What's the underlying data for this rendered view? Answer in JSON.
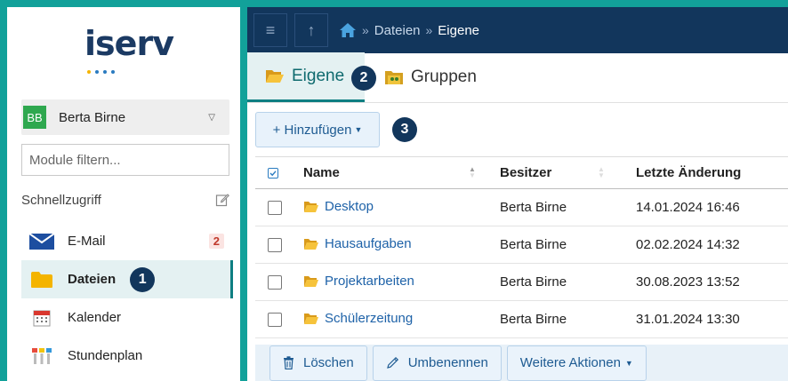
{
  "colors": {
    "frame": "#12a19a",
    "topbar": "#12365c",
    "accent": "#0e7f82",
    "link": "#1e62a8",
    "badge": "#12365c"
  },
  "logo": {
    "text": "iserv"
  },
  "user": {
    "initials": "BB",
    "name": "Berta Birne"
  },
  "module_filter": {
    "placeholder": "Module filtern..."
  },
  "quick_access": {
    "label": "Schnellzugriff",
    "icon": "edit-icon"
  },
  "nav": [
    {
      "label": "E-Mail",
      "icon": "mail-icon",
      "badge": "2",
      "active": false
    },
    {
      "label": "Dateien",
      "icon": "folder-icon",
      "active": true,
      "step": "1"
    },
    {
      "label": "Kalender",
      "icon": "calendar-icon",
      "active": false
    },
    {
      "label": "Stundenplan",
      "icon": "timetable-icon",
      "active": false
    }
  ],
  "topbar": {
    "menu_icon": "hamburger-icon",
    "up_icon": "arrow-up-icon",
    "breadcrumb": [
      {
        "label": "Dateien"
      },
      {
        "label": "Eigene"
      }
    ]
  },
  "tabs": [
    {
      "label": "Eigene",
      "active": true,
      "step": "2"
    },
    {
      "label": "Gruppen",
      "active": false
    }
  ],
  "toolbar": {
    "add_label": "+ Hinzufügen",
    "step": "3"
  },
  "table": {
    "headers": {
      "name": "Name",
      "owner": "Besitzer",
      "modified": "Letzte Änderung"
    },
    "rows": [
      {
        "name": "Desktop",
        "owner": "Berta Birne",
        "modified": "14.01.2024 16:46"
      },
      {
        "name": "Hausaufgaben",
        "owner": "Berta Birne",
        "modified": "02.02.2024 14:32"
      },
      {
        "name": "Projektarbeiten",
        "owner": "Berta Birne",
        "modified": "30.08.2023 13:52"
      },
      {
        "name": "Schülerzeitung",
        "owner": "Berta Birne",
        "modified": "31.01.2024 13:30"
      }
    ]
  },
  "actions": {
    "delete_label": "Löschen",
    "rename_label": "Umbenennen",
    "more_label": "Weitere Aktionen"
  }
}
